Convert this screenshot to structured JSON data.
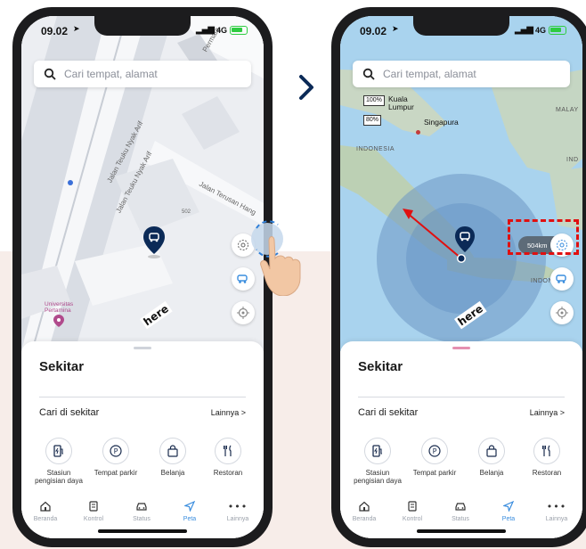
{
  "colors": {
    "brand_navy": "#0b2a57",
    "accent_blue": "#3a8dde",
    "annotation_red": "#e01010",
    "background_band": "#f7ede9"
  },
  "status_bar": {
    "left_time": "09.02",
    "right_time": "09.02",
    "network": "4G"
  },
  "search": {
    "placeholder": "Cari tempat, alamat"
  },
  "left_map": {
    "street_1": "Jalan Teuku Nyak Arif",
    "street_2": "Jalan Teuku Nyak Arif",
    "street_3": "Jalan Terusan Hang",
    "street_4": "Permata",
    "building_number": "502",
    "poi_1": "Universitas",
    "poi_2": "Pertamina",
    "watermark": "here"
  },
  "right_map": {
    "scale_1": "100%",
    "scale_2": "80%",
    "city_1": "Kuala",
    "city_1b": "Lumpur",
    "city_2": "Singapura",
    "country_1": "INDONESIA",
    "country_2": "MALAY",
    "country_3": "IND",
    "country_4": "INDONE",
    "radius_label": "504km",
    "watermark": "here"
  },
  "sheet": {
    "title": "Sekitar",
    "nearby_label": "Cari di sekitar",
    "more_label": "Lainnya >",
    "categories": [
      {
        "icon": "charging-station-icon",
        "label": "Stasiun pengisian daya"
      },
      {
        "icon": "parking-icon",
        "label": "Tempat parkir"
      },
      {
        "icon": "shopping-bag-icon",
        "label": "Belanja"
      },
      {
        "icon": "restaurant-icon",
        "label": "Restoran"
      }
    ]
  },
  "tabbar": {
    "tabs": [
      {
        "icon": "home-icon",
        "label": "Beranda"
      },
      {
        "icon": "control-icon",
        "label": "Kontrol"
      },
      {
        "icon": "car-icon",
        "label": "Status"
      },
      {
        "icon": "navigation-icon",
        "label": "Peta",
        "active": true
      },
      {
        "icon": "more-icon",
        "label": "Lainnya"
      }
    ]
  }
}
